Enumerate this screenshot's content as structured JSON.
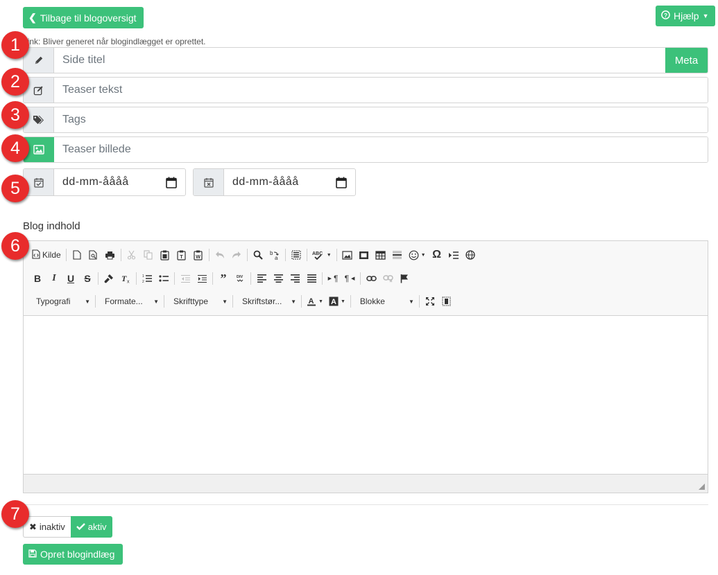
{
  "header": {
    "back_label": "Tilbage til blogoversigt",
    "help_label": "Hjælp",
    "link_note": "Link: Bliver generet når blogindlægget er oprettet."
  },
  "form": {
    "title_placeholder": "Side titel",
    "meta_label": "Meta",
    "teaser_text_placeholder": "Teaser tekst",
    "tags_placeholder": "Tags",
    "teaser_image_placeholder": "Teaser billede",
    "start_date_placeholder": "dd-mm-åååå",
    "end_date_placeholder": "dd-mm-åååå",
    "blog_content_label": "Blog indhold"
  },
  "editor": {
    "source_label": "Kilde",
    "combos": {
      "typografi": "Typografi",
      "formater": "Formate...",
      "skrifttype": "Skrifttype",
      "skriftstorrelse": "Skriftstør...",
      "blokke": "Blokke"
    }
  },
  "status": {
    "inactive_label": "inaktiv",
    "active_label": "aktiv",
    "selected": "aktiv"
  },
  "actions": {
    "create_label": "Opret blogindlæg"
  },
  "annotations": [
    "1",
    "2",
    "3",
    "4",
    "5",
    "6",
    "7"
  ],
  "colors": {
    "accent": "#3cc17a",
    "badge": "#e82c2c",
    "addon_bg": "#e9ecef"
  }
}
